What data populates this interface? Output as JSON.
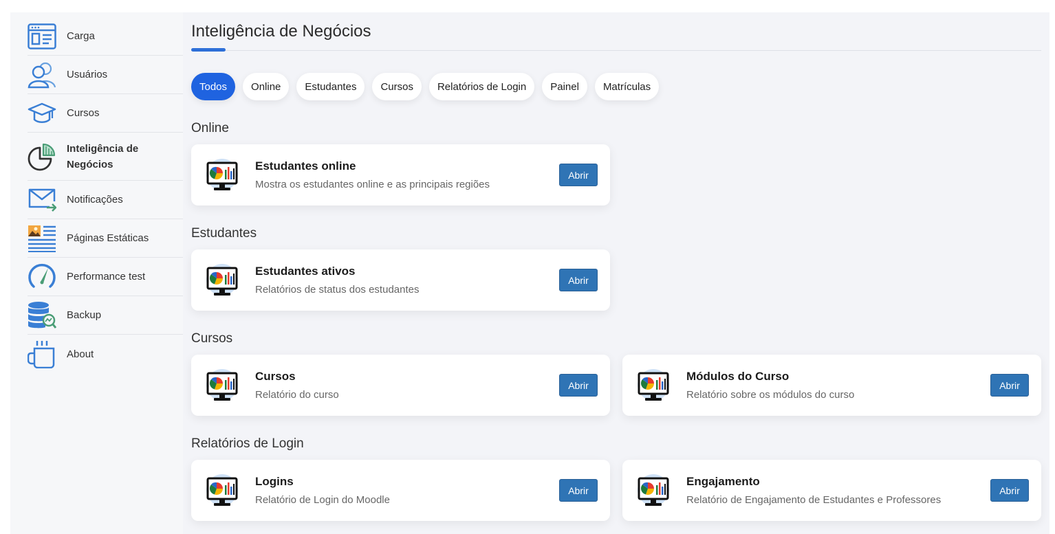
{
  "sidebar": {
    "items": [
      {
        "label": "Carga",
        "icon": "upload-form-icon"
      },
      {
        "label": "Usuários",
        "icon": "users-icon"
      },
      {
        "label": "Cursos",
        "icon": "graduation-cap-icon"
      },
      {
        "label": "Inteligência de Negócios",
        "label_line1": "Inteligência de",
        "label_line2": "Negócios",
        "icon": "pie-chart-icon"
      },
      {
        "label": "Notificações",
        "icon": "mail-arrow-icon"
      },
      {
        "label": "Páginas Estáticas",
        "icon": "static-page-icon"
      },
      {
        "label": "Performance test",
        "icon": "gauge-icon"
      },
      {
        "label": "Backup",
        "icon": "database-search-icon"
      },
      {
        "label": "About",
        "icon": "mug-icon"
      }
    ]
  },
  "main": {
    "title": "Inteligência de Negócios",
    "tabs": [
      "Todos",
      "Online",
      "Estudantes",
      "Cursos",
      "Relatórios de Login",
      "Painel",
      "Matrículas"
    ],
    "active_tab": "Todos",
    "open_label": "Abrir",
    "sections": [
      {
        "title": "Online",
        "cards": [
          {
            "title": "Estudantes online",
            "description": "Mostra os estudantes online e as principais regiões"
          }
        ]
      },
      {
        "title": "Estudantes",
        "cards": [
          {
            "title": "Estudantes ativos",
            "description": "Relatórios de status dos estudantes"
          }
        ]
      },
      {
        "title": "Cursos",
        "cards": [
          {
            "title": "Cursos",
            "description": "Relatório do curso"
          },
          {
            "title": "Módulos do Curso",
            "description": "Relatório sobre os módulos do curso"
          }
        ]
      },
      {
        "title": "Relatórios de Login",
        "cards": [
          {
            "title": "Logins",
            "description": "Relatório de Login do Moodle"
          },
          {
            "title": "Engajamento",
            "description": "Relatório de Engajamento de Estudantes e Professores"
          }
        ]
      }
    ]
  },
  "colors": {
    "accent": "#1f63e0",
    "button": "#2f74b5",
    "main_bg": "#f3f4f8",
    "sidebar_bg": "#f6f7f9"
  }
}
